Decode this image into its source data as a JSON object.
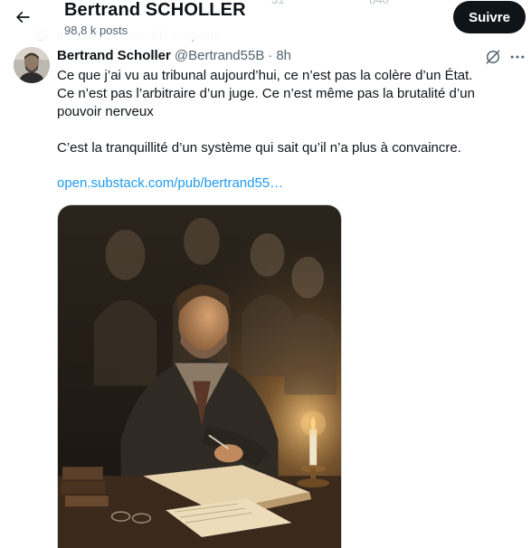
{
  "header": {
    "profile_name": "Bertrand SCHOLLER",
    "post_count": "98,8 k posts",
    "follow_label": "Suivre",
    "stat_1": "31",
    "stat_2": "840"
  },
  "repost": {
    "text": "Bertrand SCHOLLER a reposté"
  },
  "tweet": {
    "author_name": "Bertrand Scholler",
    "author_handle": "@Bertrand55B",
    "separator": "·",
    "time": "8h",
    "paragraph_1_line_1": "Ce que j’ai vu au tribunal aujourd’hui, ce n’est pas la colère d’un État.",
    "paragraph_1_line_2": "Ce n’est pas l’arbitraire d’un juge. Ce n’est même pas la brutalité d’un",
    "paragraph_1_line_3": "pouvoir nerveux",
    "paragraph_2": "C’est la tranquillité d’un système qui sait qu’il n’a plus à convaincre.",
    "link": "open.substack.com/pub/bertrand55…"
  },
  "icons": {
    "back": "arrow-left-icon",
    "repost": "repost-icon",
    "grok": "grok-icon",
    "more": "more-icon"
  },
  "colors": {
    "link": "#1d9bf0",
    "follow_bg": "#0f1419",
    "secondary_text": "#536471"
  }
}
